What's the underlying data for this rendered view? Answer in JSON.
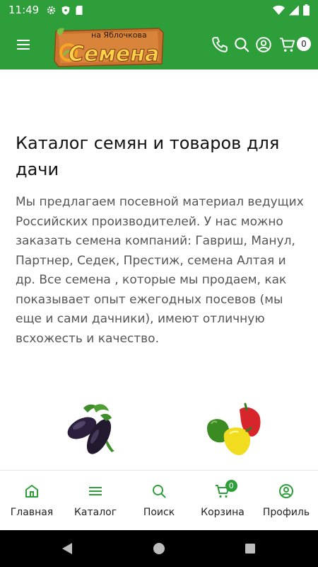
{
  "status_bar": {
    "time": "11:49"
  },
  "header": {
    "logo_small_text": "на Яблочкова",
    "logo_big_text": "Семена",
    "cart_count": "0"
  },
  "main": {
    "title": "Каталог семян и товаров для дачи",
    "description": "Мы предлагаем посевной материал ведущих Российских производителей. У нас можно заказать семена компаний: Гавриш, Манул, Партнер, Седек, Престиж, семена Алтая и др. Все семена , которые мы продаем, как показывает опыт ежегодных посевов (мы еще и сами дачники), имеют отличную всхожесть и качество."
  },
  "bottom_nav": {
    "items": [
      {
        "label": "Главная",
        "icon": "home-icon"
      },
      {
        "label": "Каталог",
        "icon": "menu-icon"
      },
      {
        "label": "Поиск",
        "icon": "search-icon"
      },
      {
        "label": "Корзина",
        "icon": "cart-icon",
        "badge": "0"
      },
      {
        "label": "Профиль",
        "icon": "profile-icon"
      }
    ]
  },
  "colors": {
    "brand_green": "#2e9e3a",
    "logo_orange": "#e8862a"
  }
}
